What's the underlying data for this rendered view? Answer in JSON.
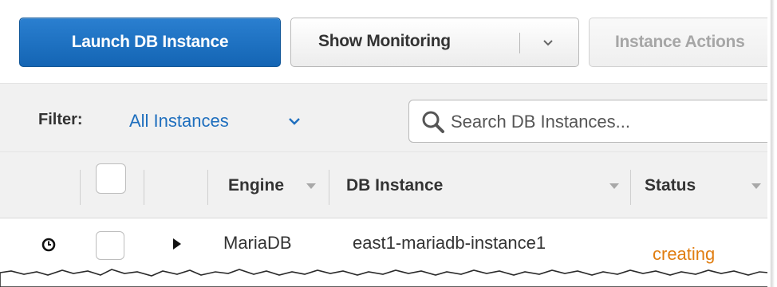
{
  "toolbar": {
    "launch_label": "Launch DB Instance",
    "monitoring_label": "Show Monitoring",
    "actions_label": "Instance Actions"
  },
  "filter": {
    "label": "Filter:",
    "value": "All Instances",
    "search_placeholder": "Search DB Instances..."
  },
  "table": {
    "columns": [
      "Engine",
      "DB Instance",
      "Status"
    ],
    "rows": [
      {
        "engine": "MariaDB",
        "db_instance": "east1-mariadb-instance1",
        "status": "creating"
      }
    ]
  },
  "colors": {
    "primary_button": "#1a6fc4",
    "link": "#1f6fbe",
    "status_creating": "#e07d10"
  },
  "icons": {
    "search": "search-icon",
    "clock": "clock-icon",
    "expand": "triangle-right-icon",
    "dropdown": "chevron-down-icon"
  }
}
